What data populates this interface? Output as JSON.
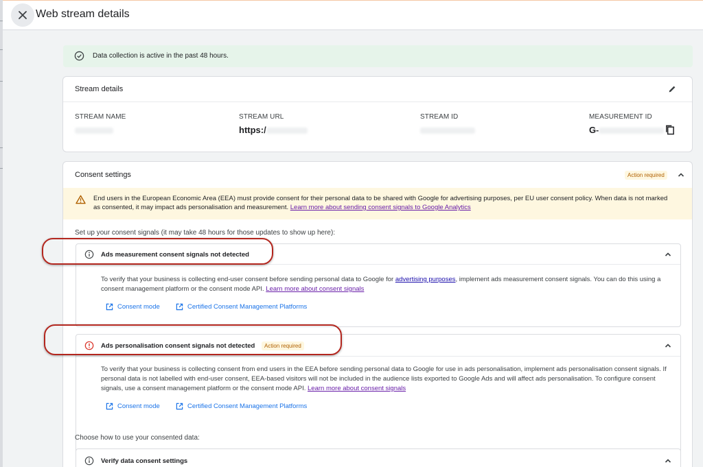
{
  "window": {
    "title": "Web stream details"
  },
  "banner": {
    "text": "Data collection is active in the past 48 hours."
  },
  "stream_details": {
    "title": "Stream details",
    "fields": [
      {
        "label": "STREAM NAME",
        "value": ""
      },
      {
        "label": "STREAM URL",
        "value": "https:/"
      },
      {
        "label": "STREAM ID",
        "value": ""
      },
      {
        "label": "MEASUREMENT ID",
        "value": "G-"
      }
    ]
  },
  "consent": {
    "title": "Consent settings",
    "badge": "Action required",
    "warning_text": "End users in the European Economic Area (EEA) must provide consent for their personal data to be shared with Google for advertising purposes, per EU user consent policy. When data is not marked as consented, it may impact ads personalisation and measurement.",
    "warning_link": "Learn more about sending consent signals to Google Analytics",
    "setup_text": "Set up your consent signals (it may take 48 hours for those updates to show up here):",
    "measurement": {
      "title": "Ads measurement consent signals not detected",
      "body_pre": "To verify that your business is collecting end-user consent before sending personal data to Google for",
      "body_link1": "advertising purposes",
      "body_post": ", implement ads measurement consent signals. You can do this using a consent management platform or the consent mode API.",
      "body_link2": "Learn more about consent signals",
      "link_a": "Consent mode",
      "link_b": "Certified Consent Management Platforms"
    },
    "personalisation": {
      "title": "Ads personalisation consent signals not detected",
      "badge": "Action required",
      "body": "To verify that your business is collecting consent from end users in the EEA before sending personal data to Google for use in ads personalisation, implement ads personalisation consent signals. If personal data is not labelled with end-user consent, EEA-based visitors will not be included in the audience lists exported to Google Ads and will affect ads personalisation. To configure consent signals, use a consent management platform or the consent mode API.",
      "body_link": "Learn more about consent signals",
      "link_a": "Consent mode",
      "link_b": "Certified Consent Management Platforms"
    },
    "choose_text": "Choose how to use your consented data:",
    "verify": {
      "title": "Verify data consent settings"
    }
  },
  "colors": {
    "accent": "#1a73e8",
    "success_bg": "#e6f4ea",
    "warning_bg": "#fef7e0",
    "warning_text": "#b06000",
    "error": "#d93025",
    "annotation": "#b3261e"
  },
  "icons": [
    "close-icon",
    "check-circle-icon",
    "pencil-icon",
    "copy-icon",
    "chevron-up-icon",
    "warning-triangle-icon",
    "info-icon",
    "error-circle-icon",
    "open-external-icon"
  ]
}
